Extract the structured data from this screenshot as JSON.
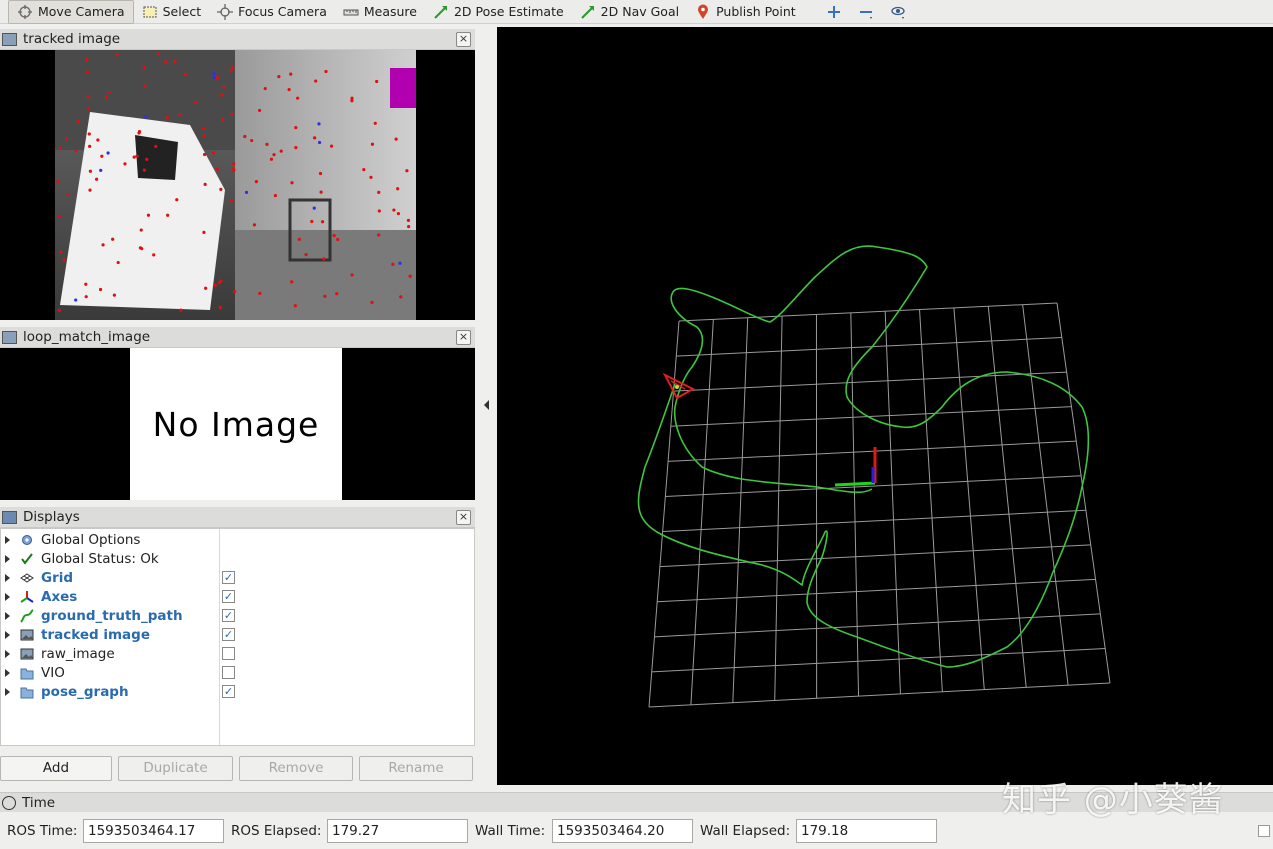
{
  "toolbar": {
    "tools": [
      {
        "label": "Move Camera",
        "icon": "move-camera-icon"
      },
      {
        "label": "Select",
        "icon": "select-icon"
      },
      {
        "label": "Focus Camera",
        "icon": "focus-camera-icon"
      },
      {
        "label": "Measure",
        "icon": "ruler-icon"
      },
      {
        "label": "2D Pose Estimate",
        "icon": "pose-arrow-icon"
      },
      {
        "label": "2D Nav Goal",
        "icon": "nav-arrow-icon"
      },
      {
        "label": "Publish Point",
        "icon": "map-pin-icon"
      }
    ],
    "active_tool": "Move Camera"
  },
  "tracked_panel": {
    "title": "tracked image",
    "close": "×"
  },
  "loop_panel": {
    "title": "loop_match_image",
    "close": "×",
    "placeholder": "No Image"
  },
  "displays": {
    "title": "Displays",
    "close": "×",
    "items": [
      {
        "label": "Global Options",
        "icon": "gear-icon",
        "checked": null,
        "highlight": false
      },
      {
        "label": "Global Status: Ok",
        "icon": "checkmark-icon",
        "checked": null,
        "highlight": false
      },
      {
        "label": "Grid",
        "icon": "grid-icon",
        "checked": true,
        "highlight": true
      },
      {
        "label": "Axes",
        "icon": "axes-icon",
        "checked": true,
        "highlight": true
      },
      {
        "label": "ground_truth_path",
        "icon": "path-icon",
        "checked": true,
        "highlight": true
      },
      {
        "label": "tracked image",
        "icon": "image-icon",
        "checked": true,
        "highlight": true
      },
      {
        "label": "raw_image",
        "icon": "image-icon",
        "checked": false,
        "highlight": false
      },
      {
        "label": "VIO",
        "icon": "folder-icon",
        "checked": false,
        "highlight": false
      },
      {
        "label": "pose_graph",
        "icon": "folder-icon",
        "checked": true,
        "highlight": true
      }
    ],
    "check_mark": "✓",
    "buttons": {
      "add": "Add",
      "duplicate": "Duplicate",
      "remove": "Remove",
      "rename": "Rename"
    }
  },
  "time": {
    "title": "Time",
    "ros_time_label": "ROS Time:",
    "ros_time": "1593503464.17",
    "ros_elapsed_label": "ROS Elapsed:",
    "ros_elapsed": "179.27",
    "wall_time_label": "Wall Time:",
    "wall_time": "1593503464.20",
    "wall_elapsed_label": "Wall Elapsed:",
    "wall_elapsed": "179.18"
  },
  "watermark": "知乎 @小葵酱",
  "colors": {
    "path": "#3ec63e",
    "grid": "#9a9a9a",
    "accent": "#2a6bb0"
  }
}
